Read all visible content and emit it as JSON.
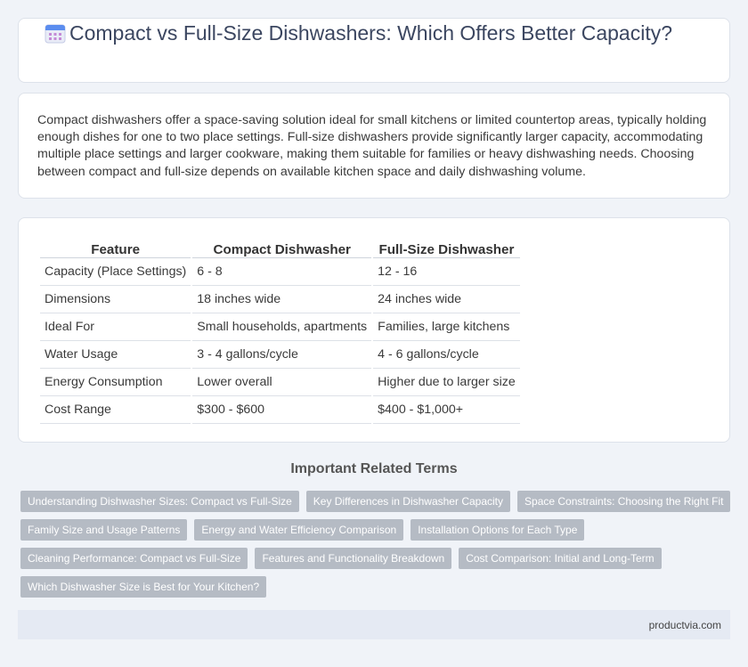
{
  "header": {
    "title": "Compact vs Full-Size Dishwashers: Which Offers Better Capacity?",
    "icon": "calendar-icon"
  },
  "intro": {
    "text": "Compact dishwashers offer a space-saving solution ideal for small kitchens or limited countertop areas, typically holding enough dishes for one to two place settings. Full-size dishwashers provide significantly larger capacity, accommodating multiple place settings and larger cookware, making them suitable for families or heavy dishwashing needs. Choosing between compact and full-size depends on available kitchen space and daily dishwashing volume."
  },
  "table": {
    "headers": [
      "Feature",
      "Compact Dishwasher",
      "Full-Size Dishwasher"
    ],
    "rows": [
      [
        "Capacity (Place Settings)",
        "6 - 8",
        "12 - 16"
      ],
      [
        "Dimensions",
        "18 inches wide",
        "24 inches wide"
      ],
      [
        "Ideal For",
        "Small households, apartments",
        "Families, large kitchens"
      ],
      [
        "Water Usage",
        "3 - 4 gallons/cycle",
        "4 - 6 gallons/cycle"
      ],
      [
        "Energy Consumption",
        "Lower overall",
        "Higher due to larger size"
      ],
      [
        "Cost Range",
        "$300 - $600",
        "$400 - $1,000+"
      ]
    ]
  },
  "related": {
    "title": "Important Related Terms",
    "rows": [
      [
        "Understanding Dishwasher Sizes: Compact vs Full-Size",
        "Key Differences in Dishwasher Capacity",
        "Space Constraints: Choosing the Right Fit"
      ],
      [
        "Family Size and Usage Patterns",
        "Energy and Water Efficiency Comparison",
        "Installation Options for Each Type"
      ],
      [
        "Cleaning Performance: Compact vs Full-Size",
        "Features and Functionality Breakdown",
        "Cost Comparison: Initial and Long-Term"
      ],
      [
        "Which Dishwasher Size is Best for Your Kitchen?"
      ]
    ]
  },
  "footer": {
    "site": "productvia.com"
  }
}
